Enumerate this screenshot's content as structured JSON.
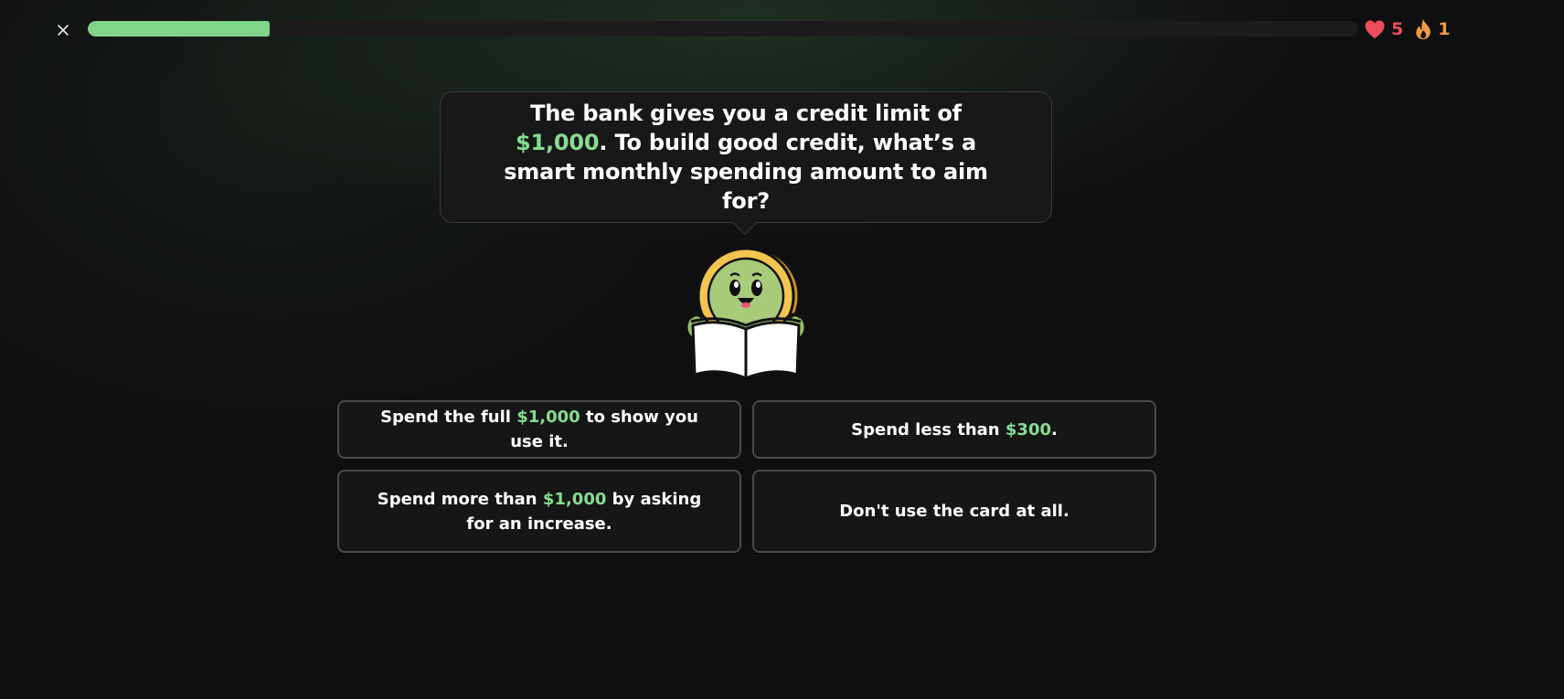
{
  "header": {
    "close_icon": "close-icon",
    "progress": 0.143,
    "progress_color": "#7fd58a",
    "hearts": "5",
    "hearts_icon": "heart-icon",
    "hearts_color": "#ef4d5c",
    "streak": "1",
    "streak_icon": "flame-icon",
    "streak_color": "#f29a45"
  },
  "question": {
    "before": "The bank gives you a credit limit of ",
    "highlight": "$1,000",
    "after": ". To build good credit, what’s a smart monthly spending amount to aim for?"
  },
  "mascot": {
    "icon": "coin-mascot-reading-book"
  },
  "accent_color": "#86dd91",
  "answers": [
    {
      "before": "Spend the full ",
      "highlight": "$1,000",
      "after": " to show you use it."
    },
    {
      "before": "Spend less than ",
      "highlight": "$300",
      "after": "."
    },
    {
      "before": "Spend more than ",
      "highlight": "$1,000",
      "after": " by asking for an increase."
    },
    {
      "text": "Don't use the card at all."
    }
  ]
}
